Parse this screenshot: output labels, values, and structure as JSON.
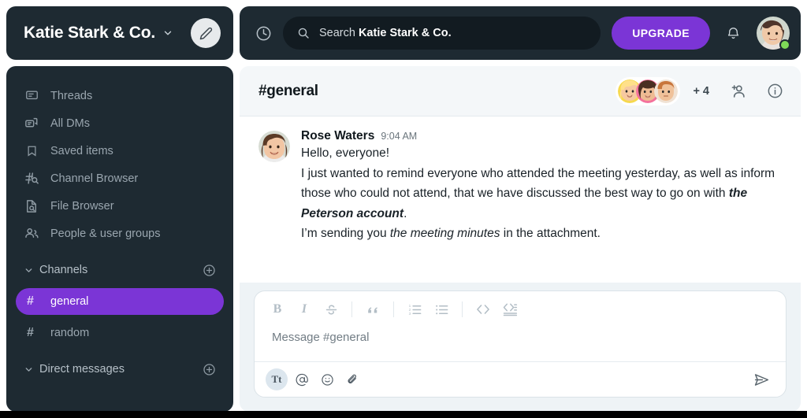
{
  "workspace": {
    "name": "Katie Stark & Co.",
    "chevron_icon": "chevron-down-icon",
    "edit_icon": "pencil-icon"
  },
  "sidebar": {
    "items": [
      {
        "label": "Threads",
        "icon": "threads-icon"
      },
      {
        "label": "All DMs",
        "icon": "all-dms-icon"
      },
      {
        "label": "Saved items",
        "icon": "bookmark-icon"
      },
      {
        "label": "Channel Browser",
        "icon": "channel-search-icon"
      },
      {
        "label": "File Browser",
        "icon": "file-search-icon"
      },
      {
        "label": "People & user groups",
        "icon": "people-icon"
      }
    ],
    "sections": [
      {
        "title": "Channels",
        "add_icon": "plus-circle-icon",
        "channels": [
          {
            "name": "general",
            "active": true
          },
          {
            "name": "random",
            "active": false
          }
        ]
      },
      {
        "title": "Direct messages",
        "add_icon": "plus-circle-icon",
        "channels": []
      }
    ]
  },
  "topbar": {
    "history_icon": "clock-icon",
    "search": {
      "icon": "search-icon",
      "label": "Search",
      "scope": "Katie Stark & Co.",
      "placeholder": "Search Katie Stark & Co."
    },
    "upgrade_label": "UPGRADE",
    "notifications_icon": "bell-icon",
    "avatar_name": "user-avatar",
    "status_color": "#7ed957"
  },
  "channel": {
    "title": "#general",
    "members_overflow": "+ 4",
    "add_people_icon": "add-person-icon",
    "info_icon": "info-icon"
  },
  "message": {
    "author": "Rose Waters",
    "time": "9:04 AM",
    "line1": "Hello, everyone!",
    "line2_a": "I just wanted to remind everyone who attended the meeting yesterday, as well as inform those who could not attend, that we have discussed the best way to go on with ",
    "line2_bold": "the Peterson account",
    "line2_b": ".",
    "line3_a": "I’m sending you ",
    "line3_italic": "the meeting minutes",
    "line3_b": " in the attachment."
  },
  "composer": {
    "placeholder": "Message #general",
    "format_buttons": [
      {
        "name": "bold-button",
        "label": "B"
      },
      {
        "name": "italic-button",
        "label": "I"
      },
      {
        "name": "strikethrough-button",
        "label": "S"
      },
      {
        "name": "blockquote-button",
        "label": "””"
      },
      {
        "name": "ordered-list-button",
        "label": ""
      },
      {
        "name": "bulleted-list-button",
        "label": ""
      },
      {
        "name": "code-button",
        "label": "<>"
      },
      {
        "name": "code-block-button",
        "label": ""
      }
    ],
    "foot_buttons": [
      {
        "name": "text-format-button",
        "label": "Tt"
      },
      {
        "name": "mention-button",
        "label": "@"
      },
      {
        "name": "emoji-button",
        "label": "☺"
      },
      {
        "name": "attachment-button",
        "label": ""
      }
    ],
    "send_icon": "send-icon"
  },
  "colors": {
    "accent": "#7b35d6",
    "sidebar_bg": "#1e2a32",
    "content_bg": "#f4f7f9"
  }
}
